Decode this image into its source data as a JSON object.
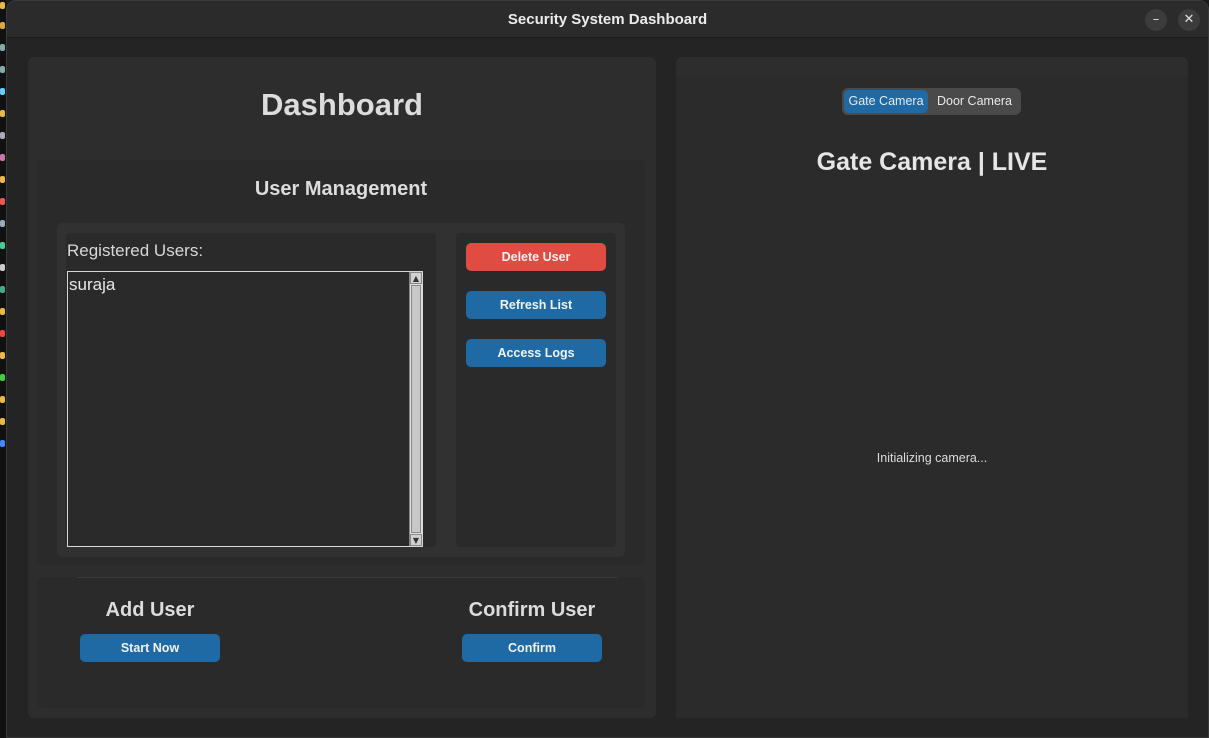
{
  "window": {
    "title": "Security System Dashboard",
    "minimize_icon": "minus-icon",
    "close_icon": "x-icon"
  },
  "dashboard": {
    "title": "Dashboard"
  },
  "user_management": {
    "title": "User Management",
    "list_label": "Registered Users:",
    "users": [
      "suraja"
    ],
    "buttons": {
      "delete": "Delete User",
      "refresh": "Refresh List",
      "logs": "Access Logs"
    }
  },
  "add_user": {
    "title": "Add User",
    "button": "Start Now"
  },
  "confirm_user": {
    "title": "Confirm User",
    "button": "Confirm"
  },
  "camera": {
    "tabs": [
      "Gate Camera",
      "Door Camera"
    ],
    "active_tab": "Gate Camera",
    "title": "Gate Camera | LIVE",
    "status": "Initializing camera..."
  },
  "colors": {
    "accent_blue": "#1f6aa5",
    "danger_red": "#e04c42",
    "background": "#242424"
  }
}
